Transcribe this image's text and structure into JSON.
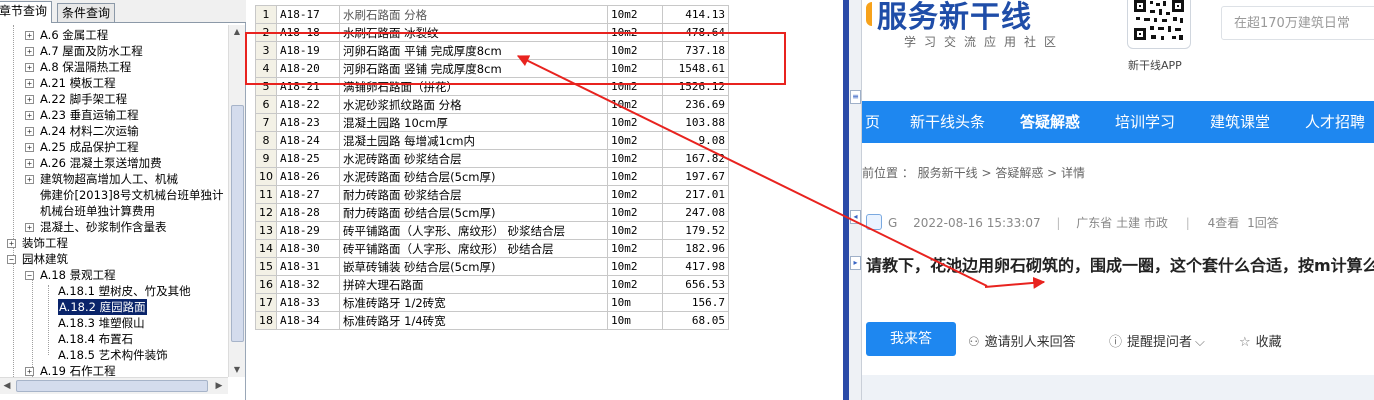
{
  "tree_panel": {
    "tabs": [
      "章节查询",
      "条件查询"
    ],
    "items": [
      {
        "label": "A.6 金属工程"
      },
      {
        "label": "A.7 屋面及防水工程"
      },
      {
        "label": "A.8 保温隔热工程"
      },
      {
        "label": "A.21 模板工程"
      },
      {
        "label": "A.22 脚手架工程"
      },
      {
        "label": "A.23 垂直运输工程"
      },
      {
        "label": "A.24 材料二次运输"
      },
      {
        "label": "A.25 成品保护工程"
      },
      {
        "label": "A.26 混凝土泵送增加费"
      },
      {
        "label": "建筑物超高增加人工、机械"
      },
      {
        "label": "佛建价[2013]8号文机械台班单独计"
      },
      {
        "label": "机械台班单独计算费用"
      },
      {
        "label": "混凝土、砂浆制作含量表"
      },
      {
        "label": "装饰工程"
      },
      {
        "label": "园林建筑"
      },
      {
        "label": "A.18 景观工程"
      },
      {
        "label": "A.18.1 塑树皮、竹及其他"
      },
      {
        "label": "A.18.2 庭园路面"
      },
      {
        "label": "A.18.3 堆塑假山"
      },
      {
        "label": "A.18.4 布置石"
      },
      {
        "label": "A.18.5 艺术构件装饰"
      },
      {
        "label": "A.19 石作工程"
      }
    ]
  },
  "grid": {
    "rows": [
      {
        "no": "1",
        "code": "A18-17",
        "name": "水刷石路面 分格",
        "unit": "10m2",
        "price": "414.13"
      },
      {
        "no": "2",
        "code": "A18-18",
        "name": "水刷石路面 冰裂纹",
        "unit": "10m2",
        "price": "478.64"
      },
      {
        "no": "3",
        "code": "A18-19",
        "name": "河卵石路面 平铺 完成厚度8cm",
        "unit": "10m2",
        "price": "737.18"
      },
      {
        "no": "4",
        "code": "A18-20",
        "name": "河卵石路面 竖铺 完成厚度8cm",
        "unit": "10m2",
        "price": "1548.61"
      },
      {
        "no": "5",
        "code": "A18-21",
        "name": "满铺卵石路面（拼花）",
        "unit": "10m2",
        "price": "1526.12"
      },
      {
        "no": "6",
        "code": "A18-22",
        "name": "水泥砂浆抓纹路面 分格",
        "unit": "10m2",
        "price": "236.69"
      },
      {
        "no": "7",
        "code": "A18-23",
        "name": "混凝土园路 10cm厚",
        "unit": "10m2",
        "price": "103.88"
      },
      {
        "no": "8",
        "code": "A18-24",
        "name": "混凝土园路 每增减1cm内",
        "unit": "10m2",
        "price": "9.08"
      },
      {
        "no": "9",
        "code": "A18-25",
        "name": "水泥砖路面 砂浆结合层",
        "unit": "10m2",
        "price": "167.82"
      },
      {
        "no": "10",
        "code": "A18-26",
        "name": "水泥砖路面 砂结合层(5cm厚)",
        "unit": "10m2",
        "price": "197.67"
      },
      {
        "no": "11",
        "code": "A18-27",
        "name": "耐力砖路面 砂浆结合层",
        "unit": "10m2",
        "price": "217.01"
      },
      {
        "no": "12",
        "code": "A18-28",
        "name": "耐力砖路面 砂结合层(5cm厚)",
        "unit": "10m2",
        "price": "247.08"
      },
      {
        "no": "13",
        "code": "A18-29",
        "name": "砖平铺路面（人字形、席纹形） 砂浆结合层",
        "unit": "10m2",
        "price": "179.52"
      },
      {
        "no": "14",
        "code": "A18-30",
        "name": "砖平铺路面（人字形、席纹形） 砂结合层",
        "unit": "10m2",
        "price": "182.96"
      },
      {
        "no": "15",
        "code": "A18-31",
        "name": "嵌草砖铺装 砂结合层(5cm厚)",
        "unit": "10m2",
        "price": "417.98"
      },
      {
        "no": "16",
        "code": "A18-32",
        "name": "拼碎大理石路面",
        "unit": "10m2",
        "price": "656.53"
      },
      {
        "no": "17",
        "code": "A18-33",
        "name": "标准砖路牙 1/2砖宽",
        "unit": "10m",
        "price": "156.7"
      },
      {
        "no": "18",
        "code": "A18-34",
        "name": "标准砖路牙 1/4砖宽",
        "unit": "10m",
        "price": "68.05"
      }
    ]
  },
  "browser": {
    "logo": "服务新干线",
    "slogan": "学习交流应用社区",
    "app_label": "新干线APP",
    "search_placeholder": "在超170万建筑日常",
    "nav": [
      "页",
      "新干线头条",
      "答疑解惑",
      "培训学习",
      "建筑课堂",
      "人才招聘"
    ],
    "breadcrumb": "前位置 ： 服务新干线 > 答疑解惑 > 详情",
    "meta": {
      "user": "G",
      "date": "2022-08-16 15:33:07",
      "location": "广东省 土建 市政",
      "views": "4查看",
      "answers": "1回答"
    },
    "question": "请教下，花池边用卵石砌筑的，围成一圈，这个套什么合适，按m计算么",
    "actions": {
      "answer": "我来答",
      "invite": "邀请别人来回答",
      "remind": "提醒提问者",
      "collect": "收藏"
    }
  },
  "colors": {
    "annotation": "#e8231f",
    "nav_bg": "#1e87f0",
    "selection": "#0a246a"
  }
}
